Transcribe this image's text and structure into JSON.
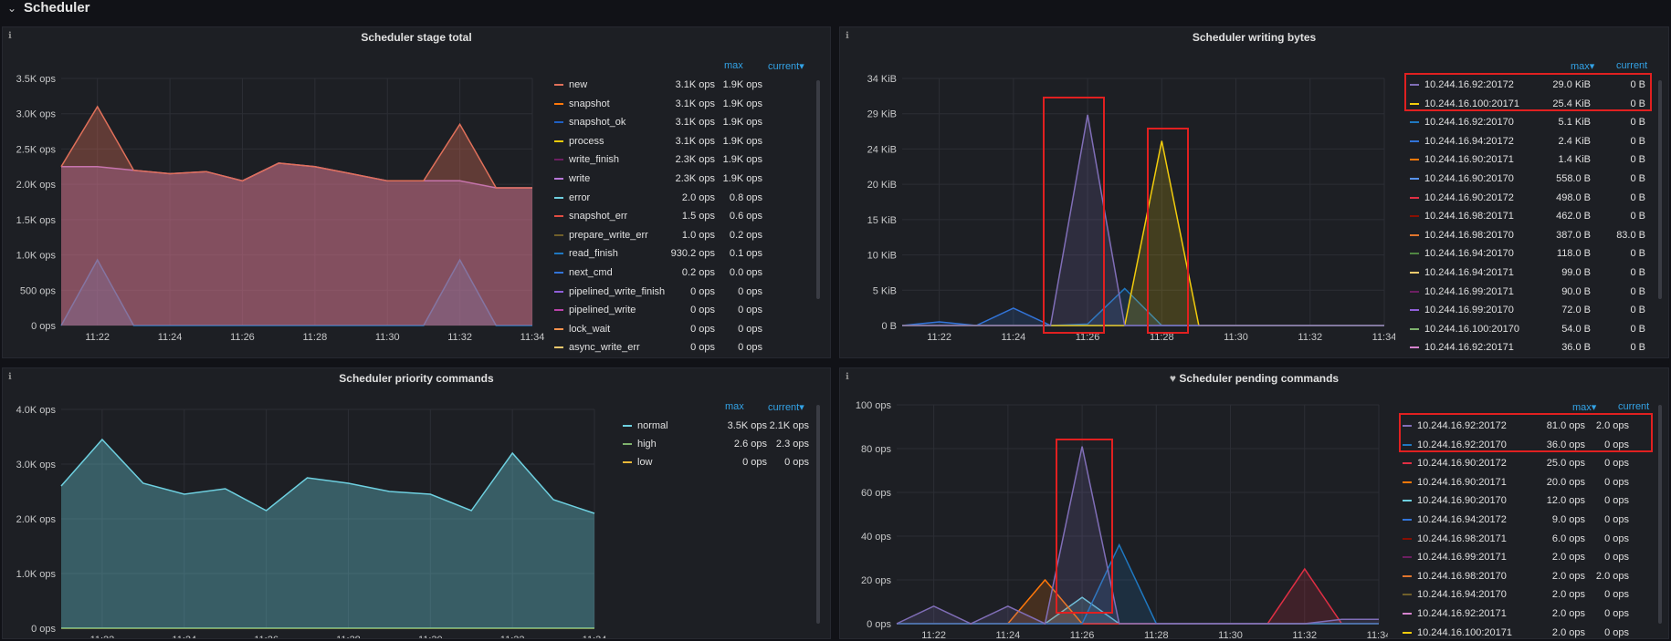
{
  "row": {
    "title": "Scheduler"
  },
  "panels": [
    {
      "id": "p1",
      "title": "Scheduler stage total",
      "yticks": [
        "3.5K ops",
        "3.0K ops",
        "2.5K ops",
        "2.0K ops",
        "1.5K ops",
        "1.0K ops",
        "500 ops",
        "0 ops"
      ],
      "xticks": [
        "11:22",
        "11:24",
        "11:26",
        "11:28",
        "11:30",
        "11:32",
        "11:34"
      ],
      "legend_headers": {
        "max": "max",
        "current": "current▾"
      },
      "legend": [
        {
          "name": "new",
          "max": "3.1K ops",
          "current": "1.9K ops",
          "color": "#e0705a"
        },
        {
          "name": "snapshot",
          "max": "3.1K ops",
          "current": "1.9K ops",
          "color": "#ff780a"
        },
        {
          "name": "snapshot_ok",
          "max": "3.1K ops",
          "current": "1.9K ops",
          "color": "#1f60c4"
        },
        {
          "name": "process",
          "max": "3.1K ops",
          "current": "1.9K ops",
          "color": "#f2cc0c"
        },
        {
          "name": "write_finish",
          "max": "2.3K ops",
          "current": "1.9K ops",
          "color": "#6d1f62"
        },
        {
          "name": "write",
          "max": "2.3K ops",
          "current": "1.9K ops",
          "color": "#b877d9"
        },
        {
          "name": "error",
          "max": "2.0 ops",
          "current": "0.8 ops",
          "color": "#6ed0e0"
        },
        {
          "name": "snapshot_err",
          "max": "1.5 ops",
          "current": "0.6 ops",
          "color": "#e24d42"
        },
        {
          "name": "prepare_write_err",
          "max": "1.0 ops",
          "current": "0.2 ops",
          "color": "#705f2a"
        },
        {
          "name": "read_finish",
          "max": "930.2 ops",
          "current": "0.1 ops",
          "color": "#1f78c1"
        },
        {
          "name": "next_cmd",
          "max": "0.2 ops",
          "current": "0.0 ops",
          "color": "#3274d9"
        },
        {
          "name": "pipelined_write_finish",
          "max": "0 ops",
          "current": "0 ops",
          "color": "#8f5fd9"
        },
        {
          "name": "pipelined_write",
          "max": "0 ops",
          "current": "0 ops",
          "color": "#ba43a9"
        },
        {
          "name": "lock_wait",
          "max": "0 ops",
          "current": "0 ops",
          "color": "#f9934e"
        },
        {
          "name": "async_write_err",
          "max": "0 ops",
          "current": "0 ops",
          "color": "#f2c96d"
        }
      ]
    },
    {
      "id": "p2",
      "title": "Scheduler writing bytes",
      "yticks": [
        "34 KiB",
        "29 KiB",
        "24 KiB",
        "20 KiB",
        "15 KiB",
        "10 KiB",
        "5 KiB",
        "0 B"
      ],
      "xticks": [
        "11:22",
        "11:24",
        "11:26",
        "11:28",
        "11:30",
        "11:32",
        "11:34"
      ],
      "legend_headers": {
        "max": "max▾",
        "current": "current"
      },
      "legend": [
        {
          "name": "10.244.16.92:20172",
          "max": "29.0 KiB",
          "current": "0 B",
          "color": "#806eb7"
        },
        {
          "name": "10.244.16.100:20171",
          "max": "25.4 KiB",
          "current": "0 B",
          "color": "#f2cc0c"
        },
        {
          "name": "10.244.16.92:20170",
          "max": "5.1 KiB",
          "current": "0 B",
          "color": "#1f78c1"
        },
        {
          "name": "10.244.16.94:20172",
          "max": "2.4 KiB",
          "current": "0 B",
          "color": "#3274d9"
        },
        {
          "name": "10.244.16.90:20171",
          "max": "1.4 KiB",
          "current": "0 B",
          "color": "#ff780a"
        },
        {
          "name": "10.244.16.90:20170",
          "max": "558.0 B",
          "current": "0 B",
          "color": "#5794f2"
        },
        {
          "name": "10.244.16.90:20172",
          "max": "498.0 B",
          "current": "0 B",
          "color": "#e02f44"
        },
        {
          "name": "10.244.16.98:20171",
          "max": "462.0 B",
          "current": "0 B",
          "color": "#890f02"
        },
        {
          "name": "10.244.16.98:20170",
          "max": "387.0 B",
          "current": "83.0 B",
          "color": "#e0752d"
        },
        {
          "name": "10.244.16.94:20170",
          "max": "118.0 B",
          "current": "0 B",
          "color": "#508642"
        },
        {
          "name": "10.244.16.94:20171",
          "max": "99.0 B",
          "current": "0 B",
          "color": "#f2c96d"
        },
        {
          "name": "10.244.16.99:20171",
          "max": "90.0 B",
          "current": "0 B",
          "color": "#6d1f62"
        },
        {
          "name": "10.244.16.99:20170",
          "max": "72.0 B",
          "current": "0 B",
          "color": "#8f5fd9"
        },
        {
          "name": "10.244.16.100:20170",
          "max": "54.0 B",
          "current": "0 B",
          "color": "#7eb26d"
        },
        {
          "name": "10.244.16.92:20171",
          "max": "36.0 B",
          "current": "0 B",
          "color": "#d683ce"
        }
      ]
    },
    {
      "id": "p3",
      "title": "Scheduler priority commands",
      "yticks": [
        "4.0K ops",
        "3.0K ops",
        "2.0K ops",
        "1.0K ops",
        "0 ops"
      ],
      "xticks": [
        "11:22",
        "11:24",
        "11:26",
        "11:28",
        "11:30",
        "11:32",
        "11:34"
      ],
      "legend_headers": {
        "max": "max",
        "current": "current▾"
      },
      "legend": [
        {
          "name": "normal",
          "max": "3.5K ops",
          "current": "2.1K ops",
          "color": "#6ed0e0"
        },
        {
          "name": "high",
          "max": "2.6 ops",
          "current": "2.3 ops",
          "color": "#7eb26d"
        },
        {
          "name": "low",
          "max": "0 ops",
          "current": "0 ops",
          "color": "#eab839"
        }
      ]
    },
    {
      "id": "p4",
      "title": "Scheduler pending commands",
      "yticks": [
        "100 ops",
        "80 ops",
        "60 ops",
        "40 ops",
        "20 ops",
        "0 ops"
      ],
      "xticks": [
        "11:22",
        "11:24",
        "11:26",
        "11:28",
        "11:30",
        "11:32",
        "11:34"
      ],
      "legend_headers": {
        "max": "max▾",
        "current": "current"
      },
      "legend": [
        {
          "name": "10.244.16.92:20172",
          "max": "81.0 ops",
          "current": "2.0 ops",
          "color": "#806eb7"
        },
        {
          "name": "10.244.16.92:20170",
          "max": "36.0 ops",
          "current": "0 ops",
          "color": "#1f78c1"
        },
        {
          "name": "10.244.16.90:20172",
          "max": "25.0 ops",
          "current": "0 ops",
          "color": "#e02f44"
        },
        {
          "name": "10.244.16.90:20171",
          "max": "20.0 ops",
          "current": "0 ops",
          "color": "#ff780a"
        },
        {
          "name": "10.244.16.90:20170",
          "max": "12.0 ops",
          "current": "0 ops",
          "color": "#6ed0e0"
        },
        {
          "name": "10.244.16.94:20172",
          "max": "9.0 ops",
          "current": "0 ops",
          "color": "#3274d9"
        },
        {
          "name": "10.244.16.98:20171",
          "max": "6.0 ops",
          "current": "0 ops",
          "color": "#890f02"
        },
        {
          "name": "10.244.16.99:20171",
          "max": "2.0 ops",
          "current": "0 ops",
          "color": "#6d1f62"
        },
        {
          "name": "10.244.16.98:20170",
          "max": "2.0 ops",
          "current": "2.0 ops",
          "color": "#e0752d"
        },
        {
          "name": "10.244.16.94:20170",
          "max": "2.0 ops",
          "current": "0 ops",
          "color": "#705f2a"
        },
        {
          "name": "10.244.16.92:20171",
          "max": "2.0 ops",
          "current": "0 ops",
          "color": "#d683ce"
        },
        {
          "name": "10.244.16.100:20171",
          "max": "2.0 ops",
          "current": "0 ops",
          "color": "#f2cc0c"
        }
      ]
    }
  ],
  "chart_data": [
    {
      "type": "area",
      "title": "Scheduler stage total",
      "x": [
        "11:21",
        "11:22",
        "11:23",
        "11:24",
        "11:25",
        "11:26",
        "11:27",
        "11:28",
        "11:29",
        "11:30",
        "11:31",
        "11:32",
        "11:33",
        "11:34"
      ],
      "ylim": [
        0,
        3500
      ],
      "series": [
        {
          "name": "new",
          "values": [
            2250,
            3100,
            2200,
            2150,
            2180,
            2050,
            2300,
            2250,
            2150,
            2050,
            2050,
            2850,
            1950,
            1950
          ]
        },
        {
          "name": "write",
          "values": [
            2250,
            2250,
            2200,
            2150,
            2180,
            2050,
            2300,
            2250,
            2150,
            2050,
            2050,
            2050,
            1950,
            1950
          ]
        },
        {
          "name": "read_finish",
          "values": [
            0,
            930,
            0,
            0,
            0,
            0,
            0,
            0,
            0,
            0,
            0,
            930,
            0,
            0
          ]
        }
      ]
    },
    {
      "type": "line",
      "title": "Scheduler writing bytes",
      "x": [
        "11:21",
        "11:22",
        "11:23",
        "11:24",
        "11:25",
        "11:26",
        "11:27",
        "11:28",
        "11:29",
        "11:30",
        "11:31",
        "11:32",
        "11:33",
        "11:34"
      ],
      "ylim": [
        0,
        34
      ],
      "series": [
        {
          "name": "10.244.16.92:20172",
          "values": [
            0,
            0,
            0,
            0,
            0,
            29.0,
            0,
            0,
            0,
            0,
            0,
            0,
            0,
            0
          ]
        },
        {
          "name": "10.244.16.100:20171",
          "values": [
            0,
            0,
            0,
            0,
            0,
            0,
            0,
            25.4,
            0,
            0,
            0,
            0,
            0,
            0
          ]
        },
        {
          "name": "10.244.16.92:20170",
          "values": [
            0,
            0,
            0,
            0,
            0,
            0.2,
            5.1,
            0,
            0,
            0,
            0,
            0,
            0,
            0
          ]
        },
        {
          "name": "10.244.16.94:20172",
          "values": [
            0,
            0.5,
            0,
            2.4,
            0,
            0,
            0,
            0,
            0,
            0,
            0,
            0,
            0,
            0
          ]
        }
      ]
    },
    {
      "type": "area",
      "title": "Scheduler priority commands",
      "x": [
        "11:21",
        "11:22",
        "11:23",
        "11:24",
        "11:25",
        "11:26",
        "11:27",
        "11:28",
        "11:29",
        "11:30",
        "11:31",
        "11:32",
        "11:33",
        "11:34"
      ],
      "ylim": [
        0,
        4000
      ],
      "series": [
        {
          "name": "normal",
          "values": [
            2600,
            3450,
            2650,
            2450,
            2550,
            2150,
            2750,
            2650,
            2500,
            2450,
            2150,
            3200,
            2350,
            2100
          ]
        },
        {
          "name": "high",
          "values": [
            2,
            2,
            2,
            2,
            2,
            2,
            2,
            2,
            2,
            2,
            2,
            2,
            2,
            2
          ]
        },
        {
          "name": "low",
          "values": [
            0,
            0,
            0,
            0,
            0,
            0,
            0,
            0,
            0,
            0,
            0,
            0,
            0,
            0
          ]
        }
      ]
    },
    {
      "type": "line",
      "title": "Scheduler pending commands",
      "x": [
        "11:21",
        "11:22",
        "11:23",
        "11:24",
        "11:25",
        "11:26",
        "11:27",
        "11:28",
        "11:29",
        "11:30",
        "11:31",
        "11:32",
        "11:33",
        "11:34"
      ],
      "ylim": [
        0,
        100
      ],
      "series": [
        {
          "name": "10.244.16.92:20172",
          "values": [
            0,
            8,
            0,
            8,
            0,
            81,
            0,
            0,
            0,
            0,
            0,
            0,
            2,
            2
          ]
        },
        {
          "name": "10.244.16.92:20170",
          "values": [
            0,
            0,
            0,
            0,
            0,
            0,
            36,
            0,
            0,
            0,
            0,
            0,
            0,
            0
          ]
        },
        {
          "name": "10.244.16.90:20172",
          "values": [
            0,
            0,
            0,
            0,
            0,
            0,
            0,
            0,
            0,
            0,
            0,
            25,
            0,
            0
          ]
        },
        {
          "name": "10.244.16.90:20171",
          "values": [
            0,
            0,
            0,
            0,
            20,
            0,
            0,
            0,
            0,
            0,
            0,
            0,
            0,
            0
          ]
        },
        {
          "name": "10.244.16.90:20170",
          "values": [
            0,
            0,
            0,
            0,
            0,
            12,
            0,
            0,
            0,
            0,
            0,
            0,
            0,
            0
          ]
        }
      ]
    }
  ]
}
